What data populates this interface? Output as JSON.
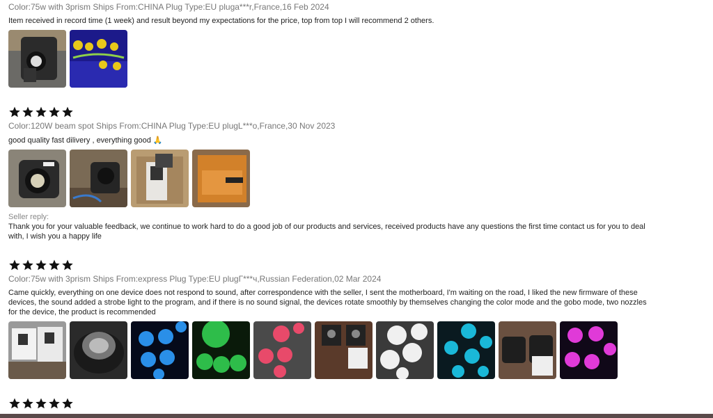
{
  "colors": {
    "star": "#111111",
    "meta": "#777777",
    "text": "#222222"
  },
  "reviews": [
    {
      "meta": "Color:75w with 3prism Ships From:CHINA Plug Type:EU pluga***r,France,16 Feb 2024",
      "text": "Item received in record time (1 week) and result beyond my expectations for the price, top from top I will recommend 2 others."
    },
    {
      "meta": "Color:120W beam spot Ships From:CHINA Plug Type:EU plugL***o,France,30 Nov 2023",
      "text": "good quality fast dilivery , everything good 🙏",
      "seller_reply_label": "Seller reply:",
      "seller_reply": "Thank you for your valuable feedback, we continue to work hard to do a good job of our products and services, received products have any questions the first time contact us for you to deal with, I wish you a happy life"
    },
    {
      "meta": "Color:75w with 3prism Ships From:express Plug Type:EU plugГ***ч,Russian Federation,02 Mar 2024",
      "text": "Came quickly, everything on one device does not respond to sound, after correspondence with the seller, I sent the motherboard, I'm waiting on the road, I liked the new firmware of these devices, the sound added a strobe light to the program, and if there is no sound signal, the devices rotate smoothly by themselves changing the color mode and the gobo mode, two nozzles for the device, the product is recommended"
    }
  ],
  "icons": {
    "star": "star-icon"
  }
}
